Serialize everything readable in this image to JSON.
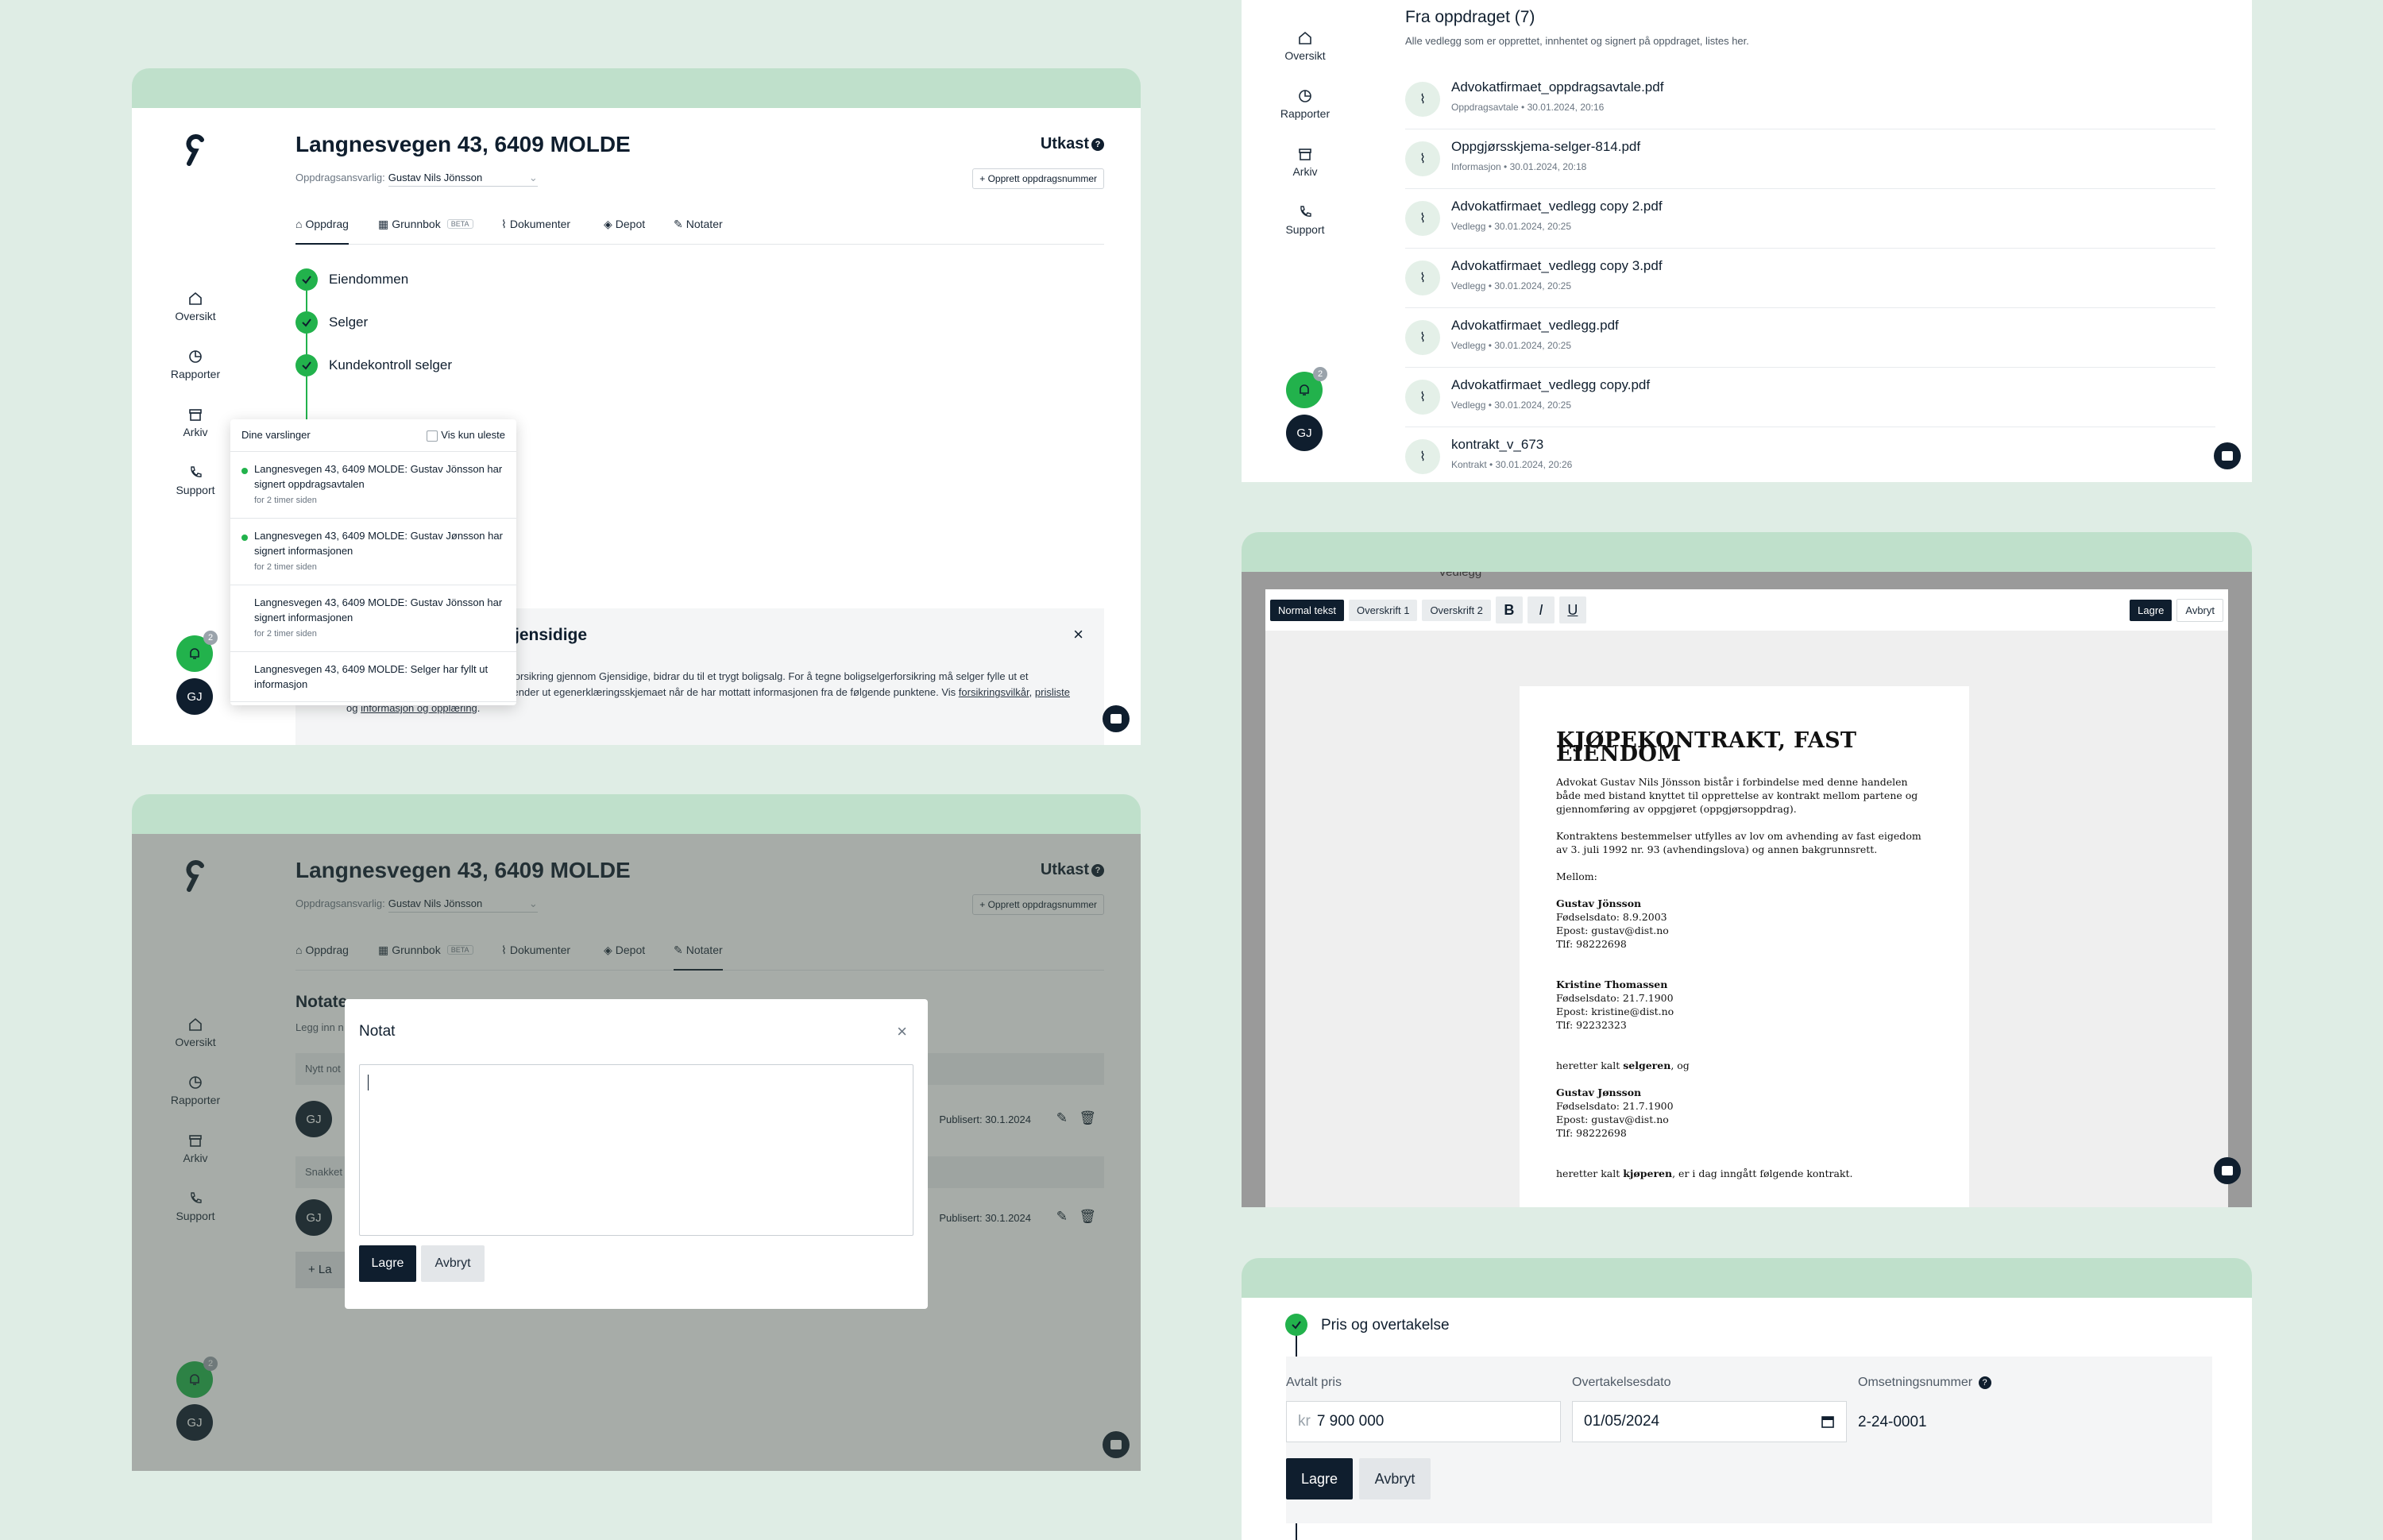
{
  "colors": {
    "accent": "#22b24c",
    "dark": "#0f1e2e",
    "mint": "#bfe0cb",
    "background": "#dfede5"
  },
  "nav": {
    "overview": "Oversikt",
    "reports": "Rapporter",
    "archive": "Arkiv",
    "support": "Support"
  },
  "user": {
    "initials": "GJ",
    "notification_count": "2"
  },
  "assignment": {
    "title": "Langnesvegen 43, 6409 MOLDE",
    "status": "Utkast",
    "help": "?",
    "responsible_label": "Oppdragsansvarlig:",
    "responsible_value": "Gustav Nils Jönsson",
    "create_number_button": "+ Opprett oppdragsnummer",
    "tabs": [
      {
        "label": "Oppdrag"
      },
      {
        "label": "Grunnbok",
        "badge": "BETA"
      },
      {
        "label": "Dokumenter"
      },
      {
        "label": "Depot"
      },
      {
        "label": "Notater"
      }
    ]
  },
  "steps": [
    "Eiendommen",
    "Selger",
    "Kundekontroll selger"
  ],
  "notifications": {
    "title": "Dine varslinger",
    "filter_label": "Vis kun uleste",
    "items": [
      {
        "text": "Langnesvegen 43, 6409 MOLDE: Gustav Jönsson har signert oppdragsavtalen",
        "time": "for 2 timer siden"
      },
      {
        "text": "Langnesvegen 43, 6409 MOLDE: Gustav Jønsson har signert informasjonen",
        "time": "for 2 timer siden"
      },
      {
        "text": "Langnesvegen 43, 6409 MOLDE: Gustav Jönsson har signert informasjonen",
        "time": "for 2 timer siden"
      },
      {
        "text": "Langnesvegen 43, 6409 MOLDE: Selger har fyllt ut informasjon",
        "time": ""
      }
    ]
  },
  "insurance": {
    "title_fragment": "ra Gjensidige",
    "close": "×",
    "body_start": "Ved å tilby kundene dine boligselgerforsikring gjennom Gjensidige, bidrar du til et trygt boligsalg. For å tegne boligselgerforsikring må selger fylle ut et egenerklæringsskjema. Gjensidige sender ut egenerklæringsskjemaet når de har mottatt informasjonen fra de følgende punktene. Vis ",
    "link_terms": "forsikringsvilkår",
    "sep1": ",",
    "link_prices": "prisliste",
    "sep2": " og ",
    "link_info": "informasjon og opplæring",
    "end": "."
  },
  "notes_page": {
    "heading_fragment": "Notate",
    "subtitle_fragment": "Legg inn n",
    "row1_label_fragment": "Nytt not",
    "row2_label_fragment": "Snakket",
    "published_1": "Publisert: 30.1.2024",
    "published_2": "Publisert: 30.1.2024",
    "add_fragment": "+ La"
  },
  "note_modal": {
    "title": "Notat",
    "close": "×",
    "save": "Lagre",
    "cancel": "Avbryt"
  },
  "documents": {
    "title": "Fra oppdraget (7)",
    "subtitle": "Alle vedlegg som er opprettet, innhentet og signert på oppdraget, listes her.",
    "items": [
      {
        "name": "Advokatfirmaet_oppdragsavtale.pdf",
        "meta": "Oppdragsavtale  •  30.01.2024, 20:16"
      },
      {
        "name": "Oppgjørsskjema-selger-814.pdf",
        "meta": "Informasjon  •  30.01.2024, 20:18"
      },
      {
        "name": "Advokatfirmaet_vedlegg copy 2.pdf",
        "meta": "Vedlegg  •  30.01.2024, 20:25"
      },
      {
        "name": "Advokatfirmaet_vedlegg copy 3.pdf",
        "meta": "Vedlegg  •  30.01.2024, 20:25"
      },
      {
        "name": "Advokatfirmaet_vedlegg.pdf",
        "meta": "Vedlegg  •  30.01.2024, 20:25"
      },
      {
        "name": "Advokatfirmaet_vedlegg copy.pdf",
        "meta": "Vedlegg  •  30.01.2024, 20:25"
      },
      {
        "name": "kontrakt_v_673",
        "meta": "Kontrakt  •  30.01.2024, 20:26"
      }
    ]
  },
  "editor": {
    "behind_label": "Vedlegg",
    "toolbar": {
      "normal": "Normal tekst",
      "h1": "Overskrift 1",
      "h2": "Overskrift 2",
      "bold": "B",
      "italic": "I",
      "underline": "U",
      "save": "Lagre",
      "cancel": "Avbryt"
    },
    "doc": {
      "title": "KJØPEKONTRAKT, FAST EIENDOM",
      "p1": "Advokat Gustav Nils Jönsson bistår i forbindelse med denne handelen både med bistand knyttet til opprettelse av kontrakt mellom partene og gjennomføring av oppgjøret (oppgjørsoppdrag).",
      "p2": "Kontraktens bestemmelser utfylles av lov om avhending av fast eigedom av 3. juli 1992 nr. 93 (avhendingslova) og annen bakgrunnsrett.",
      "between": "Mellom:",
      "party1": {
        "name": "Gustav Jönsson",
        "birth": "Fødselsdato: 8.9.2003",
        "email": "Epost: gustav@dist.no",
        "phone": "Tlf: 98222698"
      },
      "party2": {
        "name": "Kristine Thomassen",
        "birth": "Fødselsdato: 21.7.1900",
        "email": "Epost: kristine@dist.no",
        "phone": "Tlf: 92232323"
      },
      "seller_pre": "heretter kalt ",
      "seller_word": "selgeren",
      "seller_post": ", og",
      "party3": {
        "name": "Gustav Jønsson",
        "birth": "Fødselsdato: 21.7.1900",
        "email": "Epost: gustav@dist.no",
        "phone": "Tlf: 98222698"
      },
      "buyer_pre": "heretter kalt ",
      "buyer_word": "kjøperen",
      "buyer_post": ", er i dag inngått følgende kontrakt."
    }
  },
  "price": {
    "section_title": "Pris og overtakelse",
    "price_label": "Avtalt pris",
    "price_prefix": "kr",
    "price_value": "7 900 000",
    "date_label": "Overtakelsesdato",
    "date_value": "01/05/2024",
    "turnover_label": "Omsetningsnummer",
    "turnover_value": "2-24-0001",
    "save": "Lagre",
    "cancel": "Avbryt"
  }
}
